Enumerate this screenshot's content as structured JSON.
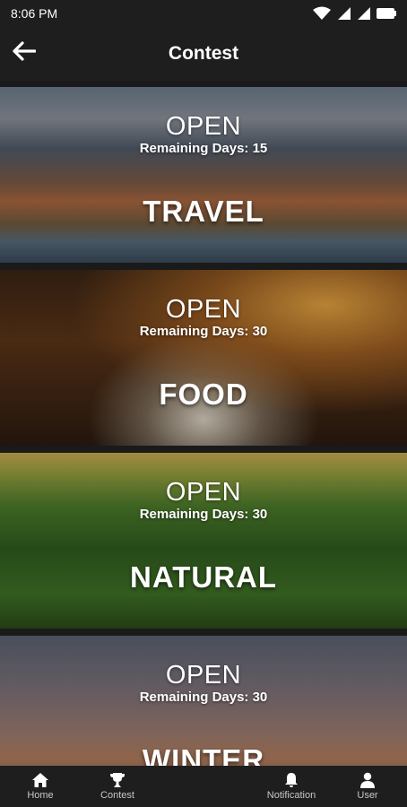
{
  "status_bar": {
    "time": "8:06 PM",
    "icons": [
      "wifi-icon",
      "signal-icon",
      "signal-icon",
      "battery-icon"
    ]
  },
  "app_bar": {
    "title": "Contest",
    "back_icon": "arrow-left-icon"
  },
  "contests": [
    {
      "status": "OPEN",
      "remaining_label": "Remaining Days:",
      "remaining_days": "15",
      "name": "TRAVEL"
    },
    {
      "status": "OPEN",
      "remaining_label": "Remaining Days:",
      "remaining_days": "30",
      "name": "FOOD"
    },
    {
      "status": "OPEN",
      "remaining_label": "Remaining Days:",
      "remaining_days": "30",
      "name": "NATURAL"
    },
    {
      "status": "OPEN",
      "remaining_label": "Remaining Days:",
      "remaining_days": "30",
      "name": "WINTER"
    }
  ],
  "bottom_nav": {
    "items": [
      {
        "label": "Home",
        "icon": "home-icon"
      },
      {
        "label": "Contest",
        "icon": "trophy-icon"
      },
      {
        "label": "Notification",
        "icon": "bell-icon"
      },
      {
        "label": "User",
        "icon": "user-icon"
      }
    ]
  },
  "colors": {
    "bar_background": "#1e1e1e",
    "page_background": "#1a1a1a",
    "nav_label": "#c8c8c8"
  }
}
